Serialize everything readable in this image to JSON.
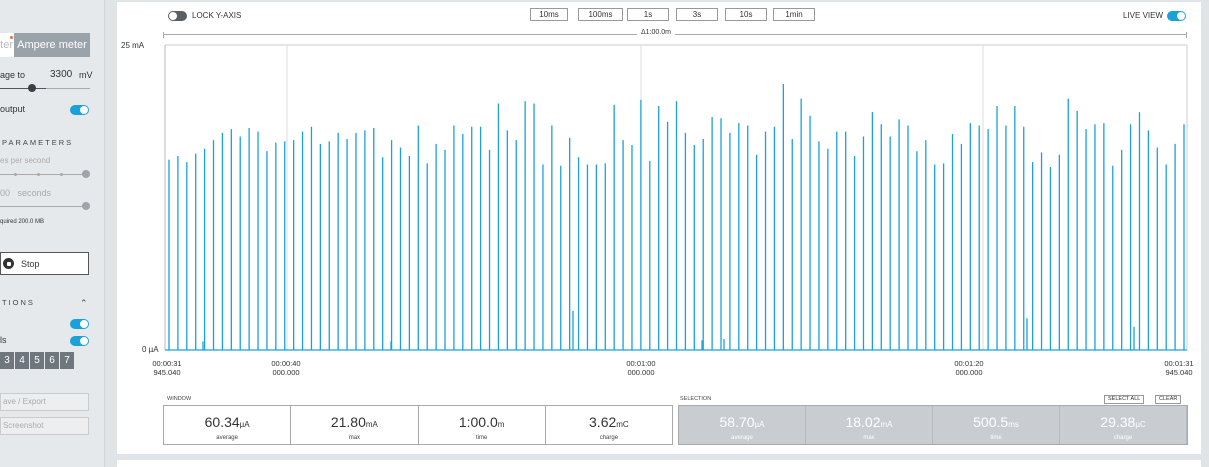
{
  "sidebar": {
    "mode_tab_left": "ter",
    "mode_tab_right": "Ampere meter",
    "voltage_label": "age to",
    "voltage_value": "3300",
    "voltage_unit": "mV",
    "output_label": "output",
    "params_heading": "PARAMETERS",
    "samples_label": "es per second",
    "duration_value": "00",
    "duration_unit": "seconds",
    "required_text": "quired 200.0 MB",
    "stop_label": "Stop",
    "options_heading": "TIONS",
    "labels_label": "ls",
    "digital_channels": [
      "3",
      "4",
      "5",
      "6",
      "7"
    ],
    "save_export_label": "ave / Export",
    "screenshot_label": "Screenshot"
  },
  "toolbar": {
    "lock_label": "LOCK Y-AXIS",
    "live_label": "LIVE VIEW",
    "windows": [
      "10ms",
      "100ms",
      "1s",
      "3s",
      "10s",
      "1min"
    ],
    "window_marker": "Δ1:00.0m"
  },
  "chart_data": {
    "type": "line",
    "y_axis": {
      "top_label": "25 mA",
      "bottom_label": "0 µA",
      "ylim_mA": [
        0,
        25
      ]
    },
    "x_ticks": [
      {
        "line1": "00:00:31",
        "line2": "945.040"
      },
      {
        "line1": "00:00:40",
        "line2": "000.000"
      },
      {
        "line1": "00:01:00",
        "line2": "000.000"
      },
      {
        "line1": "00:01:20",
        "line2": "000.000"
      },
      {
        "line1": "00:01:31",
        "line2": "945.040"
      }
    ],
    "series": [
      {
        "color": "#1aa2d8",
        "spikes_mA": [
          15.6,
          15.9,
          15.4,
          16.1,
          16.5,
          17.2,
          17.8,
          18.1,
          17.5,
          18.2,
          17.9,
          16.3,
          17.0,
          17.1,
          17.2,
          17.9,
          18.3,
          16.9,
          17.1,
          17.8,
          17.3,
          17.8,
          18.0,
          18.2,
          15.8,
          17.2,
          16.6,
          15.9,
          18.4,
          15.3,
          16.9,
          16.4,
          18.4,
          17.7,
          18.3,
          18.3,
          16.4,
          20.2,
          18.0,
          17.2,
          20.4,
          20.2,
          15.2,
          18.4,
          15.1,
          17.4,
          15.8,
          15.2,
          15.2,
          15.3,
          20.1,
          17.2,
          16.8,
          20.5,
          15.5,
          20.0,
          18.7,
          20.4,
          17.8,
          16.8,
          17.3,
          19.1,
          19.0,
          17.8,
          18.6,
          18.4,
          16.0,
          17.9,
          18.3,
          21.8,
          17.3,
          20.6,
          19.2,
          17.1,
          16.5,
          17.9,
          17.9,
          15.9,
          17.5,
          19.5,
          18.5,
          17.5,
          18.9,
          18.4,
          16.3,
          17.2,
          15.2,
          15.3,
          17.7,
          16.9,
          18.6,
          18.4,
          18.1,
          20.0,
          18.4,
          20.0,
          18.3,
          15.4,
          16.2,
          15.0,
          16.0,
          20.6,
          19.6,
          18.1,
          18.5,
          18.6,
          15.1,
          16.4,
          18.5,
          19.5,
          18.0,
          16.6,
          15.2,
          16.9,
          18.5
        ]
      }
    ],
    "small_spikes_mA": [
      0.7,
      0.7,
      3.2,
      0.8,
      0.9,
      2.6,
      1.9
    ]
  },
  "stats": {
    "window_label": "WINDOW",
    "window": [
      {
        "value": "60.34",
        "unit": "µA",
        "label": "average"
      },
      {
        "value": "21.80",
        "unit": "mA",
        "label": "max"
      },
      {
        "value": "1:00.0",
        "unit": "m",
        "label": "time"
      },
      {
        "value": "3.62",
        "unit": "mC",
        "label": "charge"
      }
    ],
    "selection_label": "SELECTION",
    "select_all_label": "SELECT ALL",
    "clear_label": "CLEAR",
    "selection": [
      {
        "value": "58.70",
        "unit": "µA",
        "label": "average"
      },
      {
        "value": "18.02",
        "unit": "mA",
        "label": "max"
      },
      {
        "value": "500.5",
        "unit": "ms",
        "label": "time"
      },
      {
        "value": "29.38",
        "unit": "µC",
        "label": "charge"
      }
    ]
  }
}
